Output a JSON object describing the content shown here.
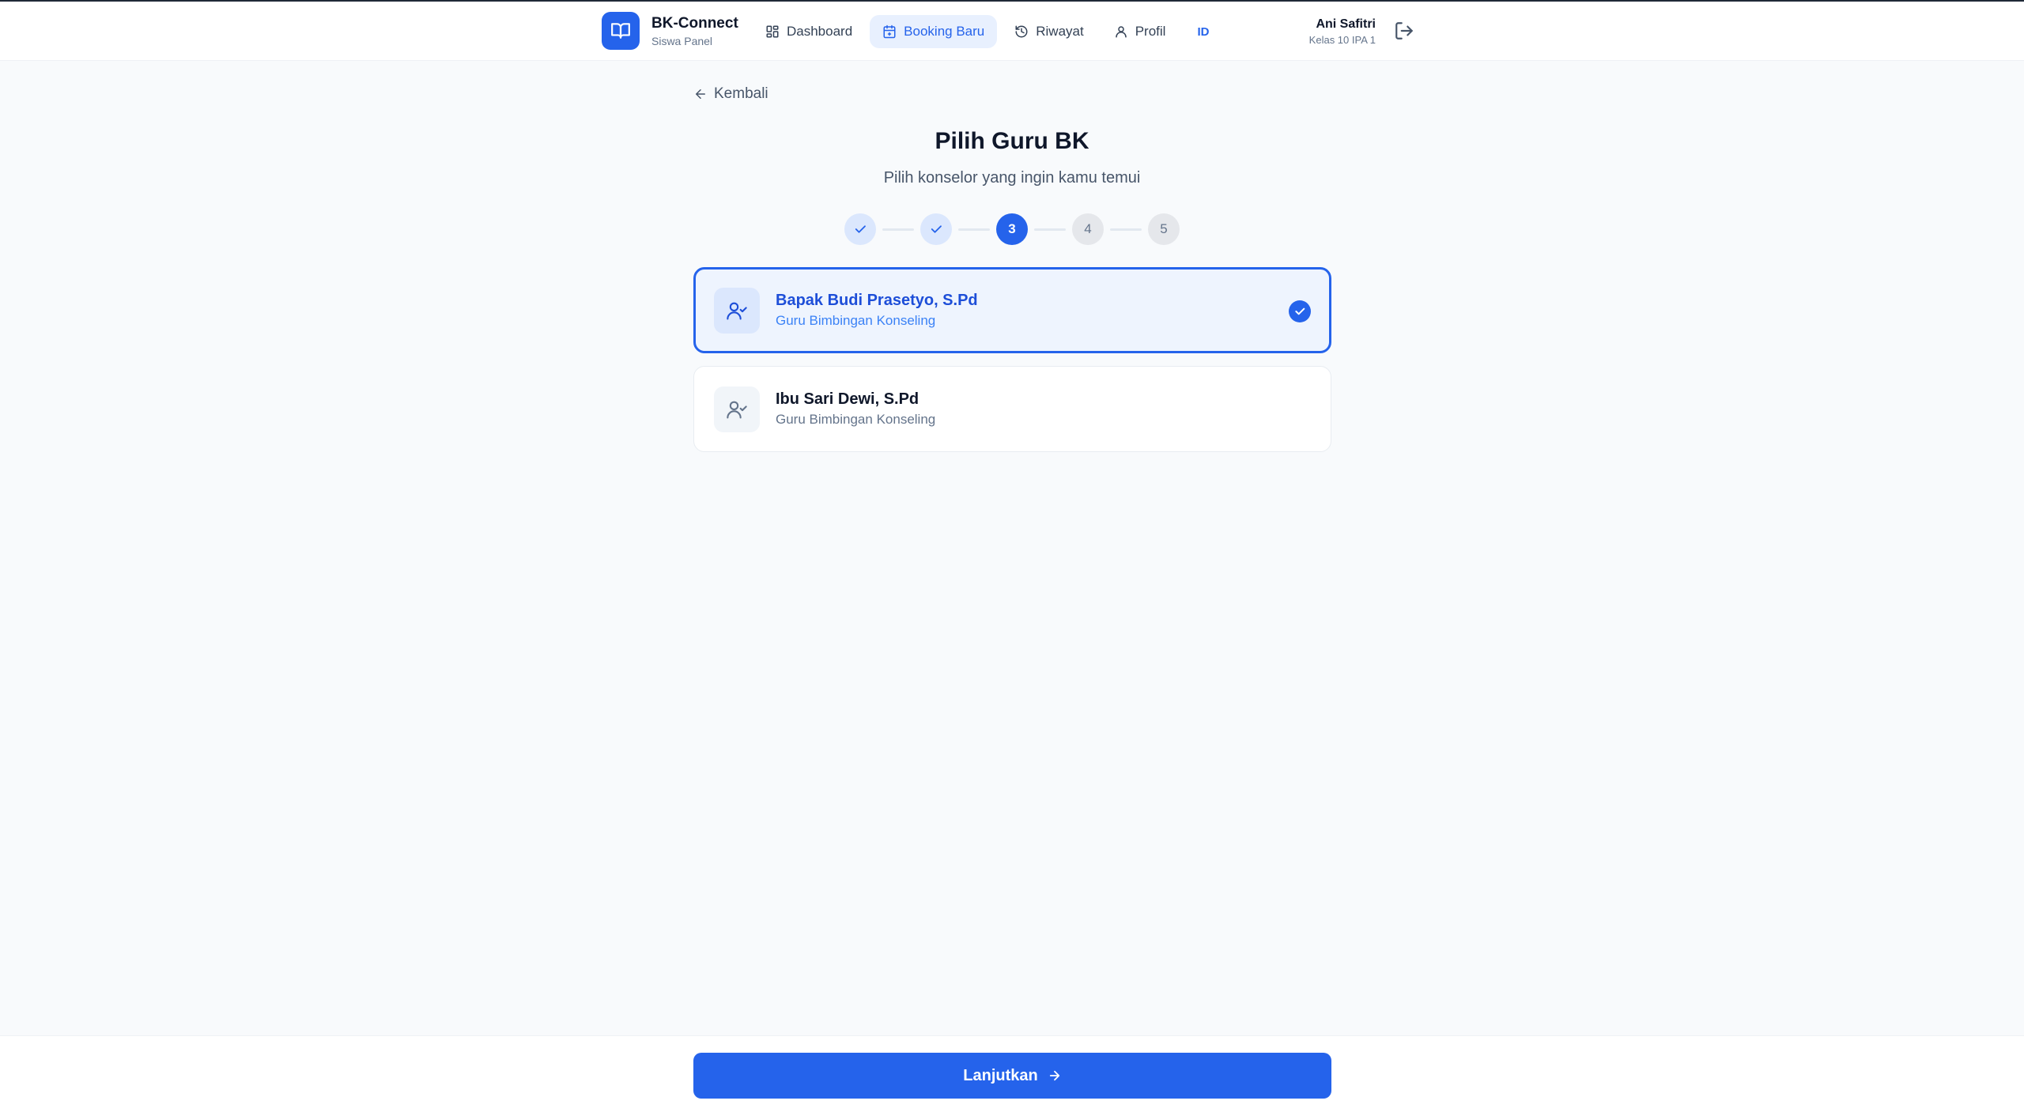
{
  "header": {
    "brand_title": "BK-Connect",
    "brand_subtitle": "Siswa Panel",
    "nav": [
      {
        "label": "Dashboard",
        "icon": "grid-icon"
      },
      {
        "label": "Booking Baru",
        "icon": "calendar-plus-icon",
        "active": true
      },
      {
        "label": "Riwayat",
        "icon": "history-icon"
      },
      {
        "label": "Profil",
        "icon": "user-icon"
      }
    ],
    "language": "ID",
    "user_name": "Ani Safitri",
    "user_class": "Kelas 10 IPA 1"
  },
  "main": {
    "back_label": "Kembali",
    "title": "Pilih Guru BK",
    "subtitle": "Pilih konselor yang ingin kamu temui",
    "steps": [
      {
        "label": "",
        "state": "done"
      },
      {
        "label": "",
        "state": "done"
      },
      {
        "label": "3",
        "state": "current"
      },
      {
        "label": "4",
        "state": "todo"
      },
      {
        "label": "5",
        "state": "todo"
      }
    ],
    "counselors": [
      {
        "name": "Bapak Budi Prasetyo, S.Pd",
        "role": "Guru Bimbingan Konseling",
        "selected": true
      },
      {
        "name": "Ibu Sari Dewi, S.Pd",
        "role": "Guru Bimbingan Konseling",
        "selected": false
      }
    ]
  },
  "footer": {
    "continue_label": "Lanjutkan"
  },
  "colors": {
    "accent": "#2563eb",
    "accent_light": "#eef4fe",
    "background": "#f8fafc"
  }
}
